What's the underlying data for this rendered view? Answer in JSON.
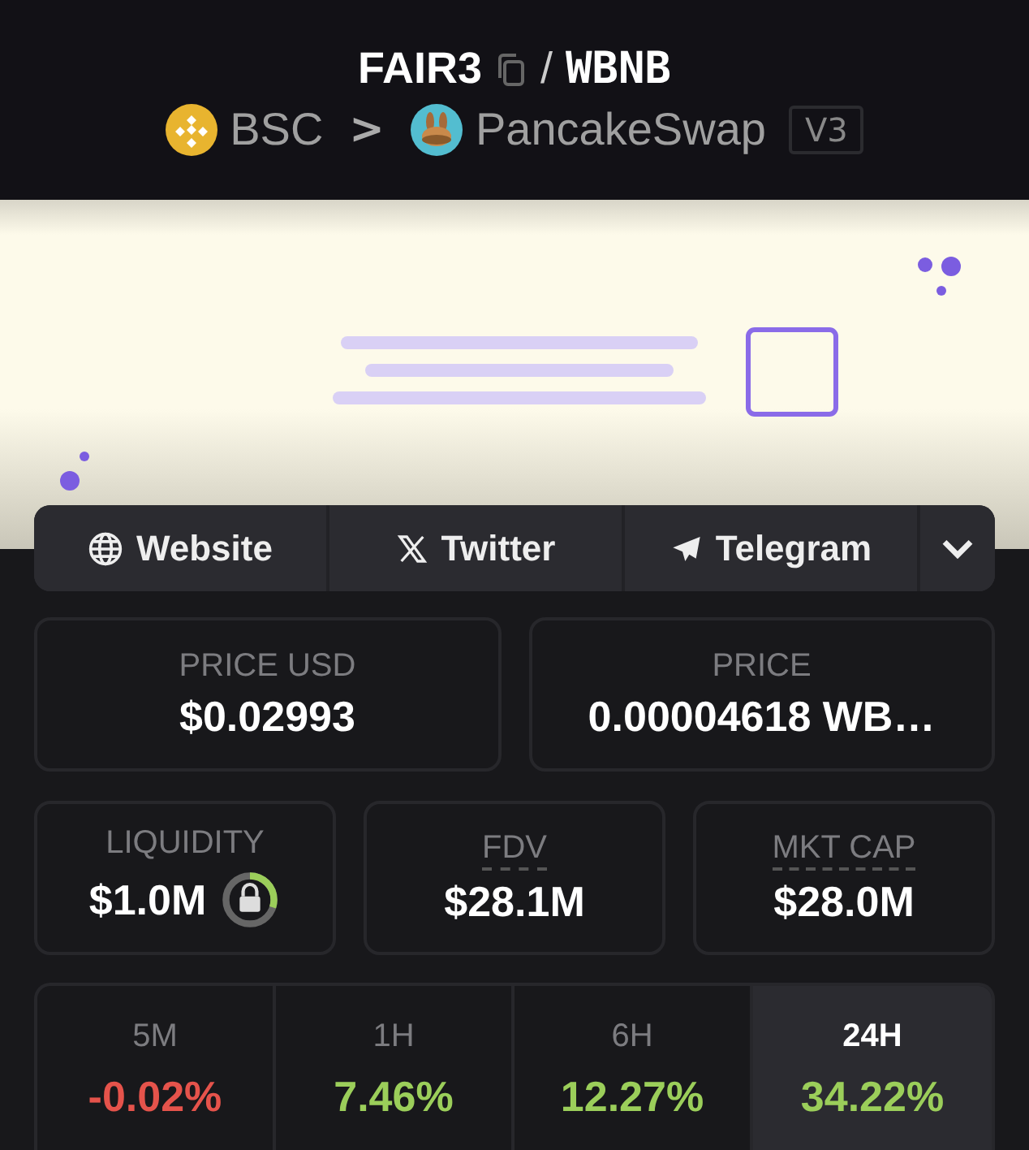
{
  "pair": {
    "base": "FAIR3",
    "separator": "/",
    "quote": "WBNB"
  },
  "route": {
    "chain": "BSC",
    "arrow": ">",
    "dex": "PancakeSwap",
    "version": "V3"
  },
  "links": [
    {
      "label": "Website",
      "kind": "globe"
    },
    {
      "label": "Twitter",
      "kind": "x"
    },
    {
      "label": "Telegram",
      "kind": "plane"
    }
  ],
  "prices": [
    {
      "label": "PRICE USD",
      "value": "$0.02993"
    },
    {
      "label": "PRICE",
      "value": "0.00004618 WB…"
    }
  ],
  "stats": [
    {
      "label": "LIQUIDITY",
      "value": "$1.0M",
      "underlined": false,
      "lock": {
        "level": 0.3
      }
    },
    {
      "label": "FDV",
      "value": "$28.1M",
      "underlined": true
    },
    {
      "label": "MKT CAP",
      "value": "$28.0M",
      "underlined": true
    }
  ],
  "periods": [
    {
      "label": "5M",
      "change": "-0.02%",
      "color": "#e5534b",
      "selected": false
    },
    {
      "label": "1H",
      "change": "7.46%",
      "color": "#9bce5a",
      "selected": false
    },
    {
      "label": "6H",
      "change": "12.27%",
      "color": "#9bce5a",
      "selected": false
    },
    {
      "label": "24H",
      "change": "34.22%",
      "color": "#9bce5a",
      "selected": true
    }
  ]
}
